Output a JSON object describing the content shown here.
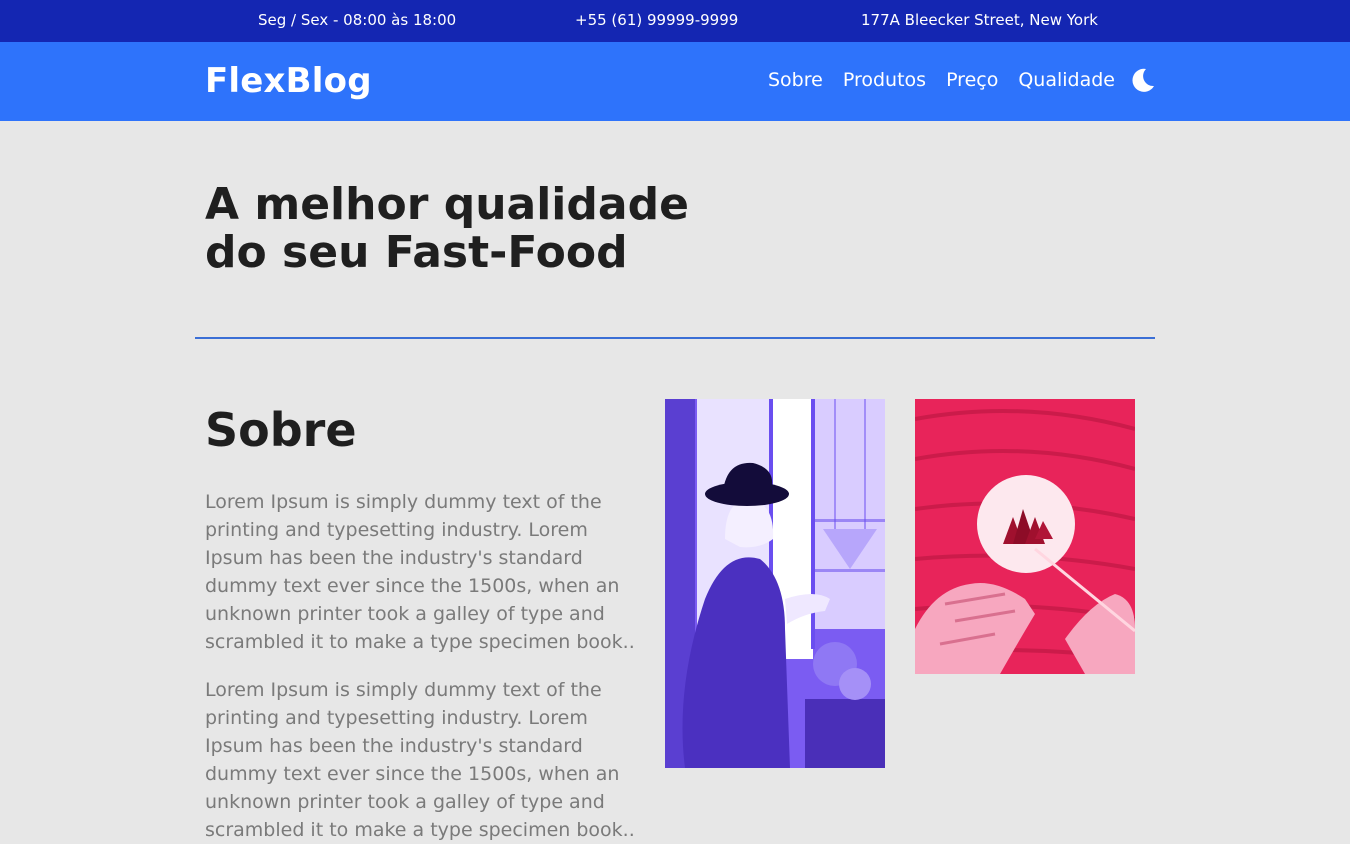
{
  "topbar": {
    "hours": "Seg / Sex - 08:00 às 18:00",
    "phone": "+55 (61) 99999-9999",
    "address": "177A Bleecker Street, New York"
  },
  "nav": {
    "logo": "FlexBlog",
    "links": [
      "Sobre",
      "Produtos",
      "Preço",
      "Qualidade"
    ],
    "theme_icon": "moon-icon"
  },
  "hero": {
    "title_line1": "A melhor qualidade",
    "title_line2": "do seu Fast-Food"
  },
  "about": {
    "title": "Sobre",
    "paragraph1": "Lorem Ipsum is simply dummy text of the printing and typesetting industry. Lorem Ipsum has been the industry's standard dummy text ever since the 1500s, when an unknown printer took a galley of type and scrambled it to make a type specimen book..",
    "paragraph2": "Lorem Ipsum is simply dummy text of the printing and typesetting industry. Lorem Ipsum has been the industry's standard dummy text ever since the 1500s, when an unknown printer took a galley of type and scrambled it to make a type specimen book.."
  },
  "colors": {
    "topbar_bg": "#1426b2",
    "navbar_bg": "#2e73fb",
    "page_bg": "#e7e7e7",
    "divider": "#3b6fd6",
    "photo1_tint": "#6a4ef0",
    "photo2_tint": "#e8245a"
  }
}
